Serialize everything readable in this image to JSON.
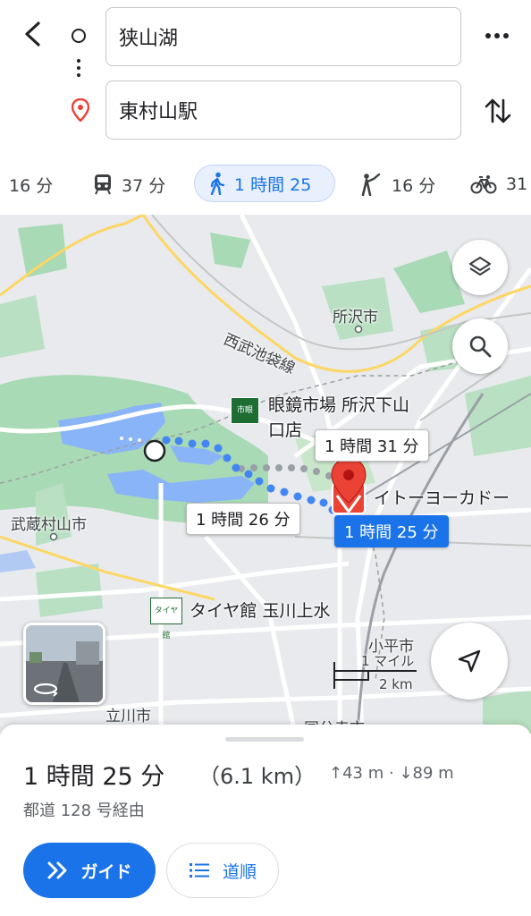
{
  "search": {
    "origin": "狭山湖",
    "destination": "東村山駅"
  },
  "modes": [
    {
      "label": "16 分",
      "icon": "car-icon"
    },
    {
      "label": "37 分",
      "icon": "train-icon"
    },
    {
      "label": "1 時間 25",
      "icon": "walk-icon",
      "selected": true
    },
    {
      "label": "16 分",
      "icon": "ride-hail-icon"
    },
    {
      "label": "31",
      "icon": "bicycle-icon"
    }
  ],
  "map": {
    "labels": {
      "tokorozawa": "所沢市",
      "seibu_line": "西武池袋線",
      "megane_1": "眼鏡市場 所沢下山",
      "megane_2": "口店",
      "ito_yokado": "イトーヨーカドー",
      "musashimurayama": "武蔵村山市",
      "taiyakan": "タイヤ館 玉川上水",
      "kodaira": "小平市",
      "tachikawa": "立川市",
      "kokubunji": "国分寺市",
      "poi_megane_icon": "市眼",
      "poi_taiya_icon": "タイヤ館"
    },
    "callouts": {
      "alt1": "1 時間 31 分",
      "alt2": "1 時間 26 分",
      "selected": "1 時間 25 分"
    },
    "scale": {
      "mile": "1 マイル",
      "km": "2 km"
    }
  },
  "summary": {
    "duration": "1 時間 25 分",
    "distance": "（6.1 km）",
    "elevation": "↑43 m · ↓89 m",
    "via": "都道 128 号経由"
  },
  "buttons": {
    "guide": "ガイド",
    "steps": "道順"
  },
  "colors": {
    "accent": "#1a73e8",
    "pin": "#ea4335",
    "water": "#8ab4f8",
    "park": "#a8dab5",
    "road_yellow": "#fdd663"
  }
}
